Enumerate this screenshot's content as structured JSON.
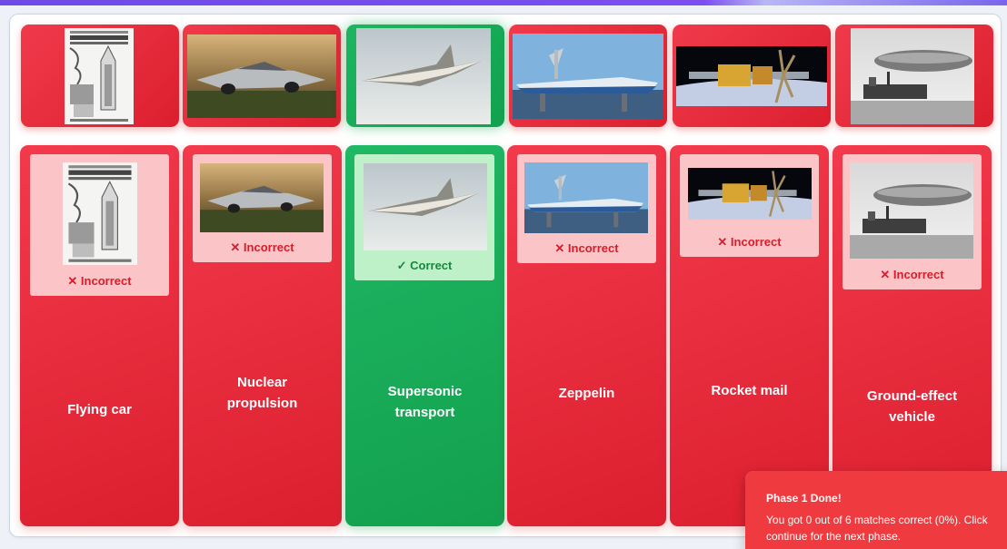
{
  "toast": {
    "title": "Phase 1 Done!",
    "line1": "You got 0 out of 6 matches correct (0%). Click",
    "line2": "continue for the next phase."
  },
  "images": [
    {
      "name": "newspaper-rocket-mail-clipping",
      "state": "incorrect"
    },
    {
      "name": "flying-car-photo",
      "state": "incorrect"
    },
    {
      "name": "supersonic-jet-photo",
      "state": "correct"
    },
    {
      "name": "ground-effect-vehicle-photo",
      "state": "incorrect"
    },
    {
      "name": "nuclear-spacecraft-render",
      "state": "incorrect"
    },
    {
      "name": "zeppelin-photo",
      "state": "incorrect"
    }
  ],
  "columns": [
    {
      "label_l1": "Flying car",
      "label_l2": "",
      "status": "✕ Incorrect",
      "state": "incorrect"
    },
    {
      "label_l1": "Nuclear",
      "label_l2": "propulsion",
      "status": "✕ Incorrect",
      "state": "incorrect"
    },
    {
      "label_l1": "Supersonic",
      "label_l2": "transport",
      "status": "✓ Correct",
      "state": "correct"
    },
    {
      "label_l1": "Zeppelin",
      "label_l2": "",
      "status": "✕ Incorrect",
      "state": "incorrect"
    },
    {
      "label_l1": "Rocket mail",
      "label_l2": "",
      "status": "✕ Incorrect",
      "state": "incorrect"
    },
    {
      "label_l1": "Ground-effect",
      "label_l2": "vehicle",
      "status": "✕ Incorrect",
      "state": "incorrect"
    }
  ],
  "colors": {
    "incorrect": "#e5283a",
    "correct": "#17aa57",
    "incorrect_card": "#fbc4c6",
    "correct_card": "#bff1c8"
  }
}
